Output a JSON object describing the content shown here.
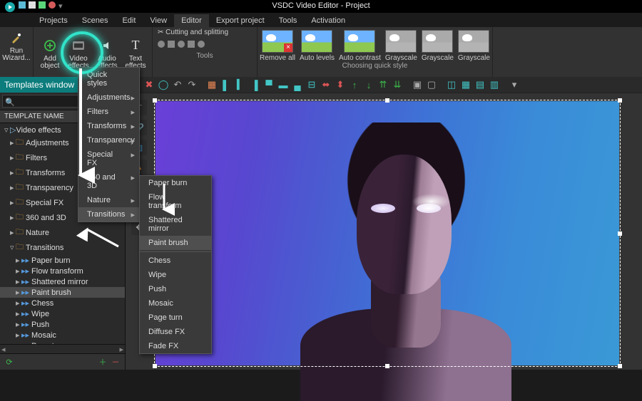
{
  "title": "VSDC Video Editor - Project",
  "menus": [
    "Projects",
    "Scenes",
    "Edit",
    "View",
    "Editor",
    "Export project",
    "Tools",
    "Activation"
  ],
  "active_menu": "Editor",
  "ribbon": {
    "run_wizard": "Run\nWizard...",
    "add_object": "Add\nobject",
    "video_effects": "Video\neffects",
    "audio_effects": "Audio\neffects",
    "text_effects": "Text\neffects",
    "cut_split": "Cutting and splitting",
    "tools_label": "Tools",
    "quick_style_label": "Choosing quick style",
    "styles": [
      "Remove all",
      "Auto levels",
      "Auto contrast",
      "Grayscale",
      "Grayscale",
      "Grayscale"
    ]
  },
  "effects_menu": [
    "Quick styles",
    "Adjustments",
    "Filters",
    "Transforms",
    "Transparency",
    "Special FX",
    "360 and 3D",
    "Nature",
    "Transitions"
  ],
  "transitions_menu": {
    "top": [
      "Paper burn",
      "Flow transform",
      "Shattered mirror",
      "Paint brush"
    ],
    "rest": [
      "Chess",
      "Wipe",
      "Push",
      "Mosaic",
      "Page turn",
      "Diffuse FX",
      "Fade FX"
    ],
    "highlighted": "Paint brush"
  },
  "templates": {
    "title": "Templates window",
    "search_placeholder": "",
    "header": "TEMPLATE NAME",
    "tree": [
      {
        "d": 0,
        "ar": "▿",
        "ic": "play",
        "t": "Video effects"
      },
      {
        "d": 1,
        "ar": "▸",
        "ic": "fld",
        "t": "Adjustments"
      },
      {
        "d": 1,
        "ar": "▸",
        "ic": "fld",
        "t": "Filters"
      },
      {
        "d": 1,
        "ar": "▸",
        "ic": "fld",
        "t": "Transforms"
      },
      {
        "d": 1,
        "ar": "▸",
        "ic": "fld",
        "t": "Transparency"
      },
      {
        "d": 1,
        "ar": "▸",
        "ic": "fld",
        "t": "Special FX"
      },
      {
        "d": 1,
        "ar": "▸",
        "ic": "fld",
        "t": "360 and 3D"
      },
      {
        "d": 1,
        "ar": "▸",
        "ic": "fld",
        "t": "Nature"
      },
      {
        "d": 1,
        "ar": "▿",
        "ic": "fld",
        "t": "Transitions"
      },
      {
        "d": 2,
        "ar": "▸",
        "ic": "fx",
        "t": "Paper burn"
      },
      {
        "d": 2,
        "ar": "▸",
        "ic": "fx",
        "t": "Flow transform"
      },
      {
        "d": 2,
        "ar": "▸",
        "ic": "fx",
        "t": "Shattered mirror"
      },
      {
        "d": 2,
        "ar": "▸",
        "ic": "fx",
        "t": "Paint brush",
        "sel": true
      },
      {
        "d": 2,
        "ar": "▸",
        "ic": "fx",
        "t": "Chess"
      },
      {
        "d": 2,
        "ar": "▸",
        "ic": "fx",
        "t": "Wipe"
      },
      {
        "d": 2,
        "ar": "▸",
        "ic": "fx",
        "t": "Push"
      },
      {
        "d": 2,
        "ar": "▸",
        "ic": "fx",
        "t": "Mosaic"
      },
      {
        "d": 2,
        "ar": "▸",
        "ic": "fx",
        "t": "Page turn"
      },
      {
        "d": 2,
        "ar": "▸",
        "ic": "fx",
        "t": "Diffuse FX"
      },
      {
        "d": 2,
        "ar": "▸",
        "ic": "fx",
        "t": "Fade FX"
      },
      {
        "d": 0,
        "ar": "▸",
        "ic": "aud",
        "t": "Audio effects"
      },
      {
        "d": 0,
        "ar": "▸",
        "ic": "txt",
        "t": "Text effects"
      }
    ]
  }
}
